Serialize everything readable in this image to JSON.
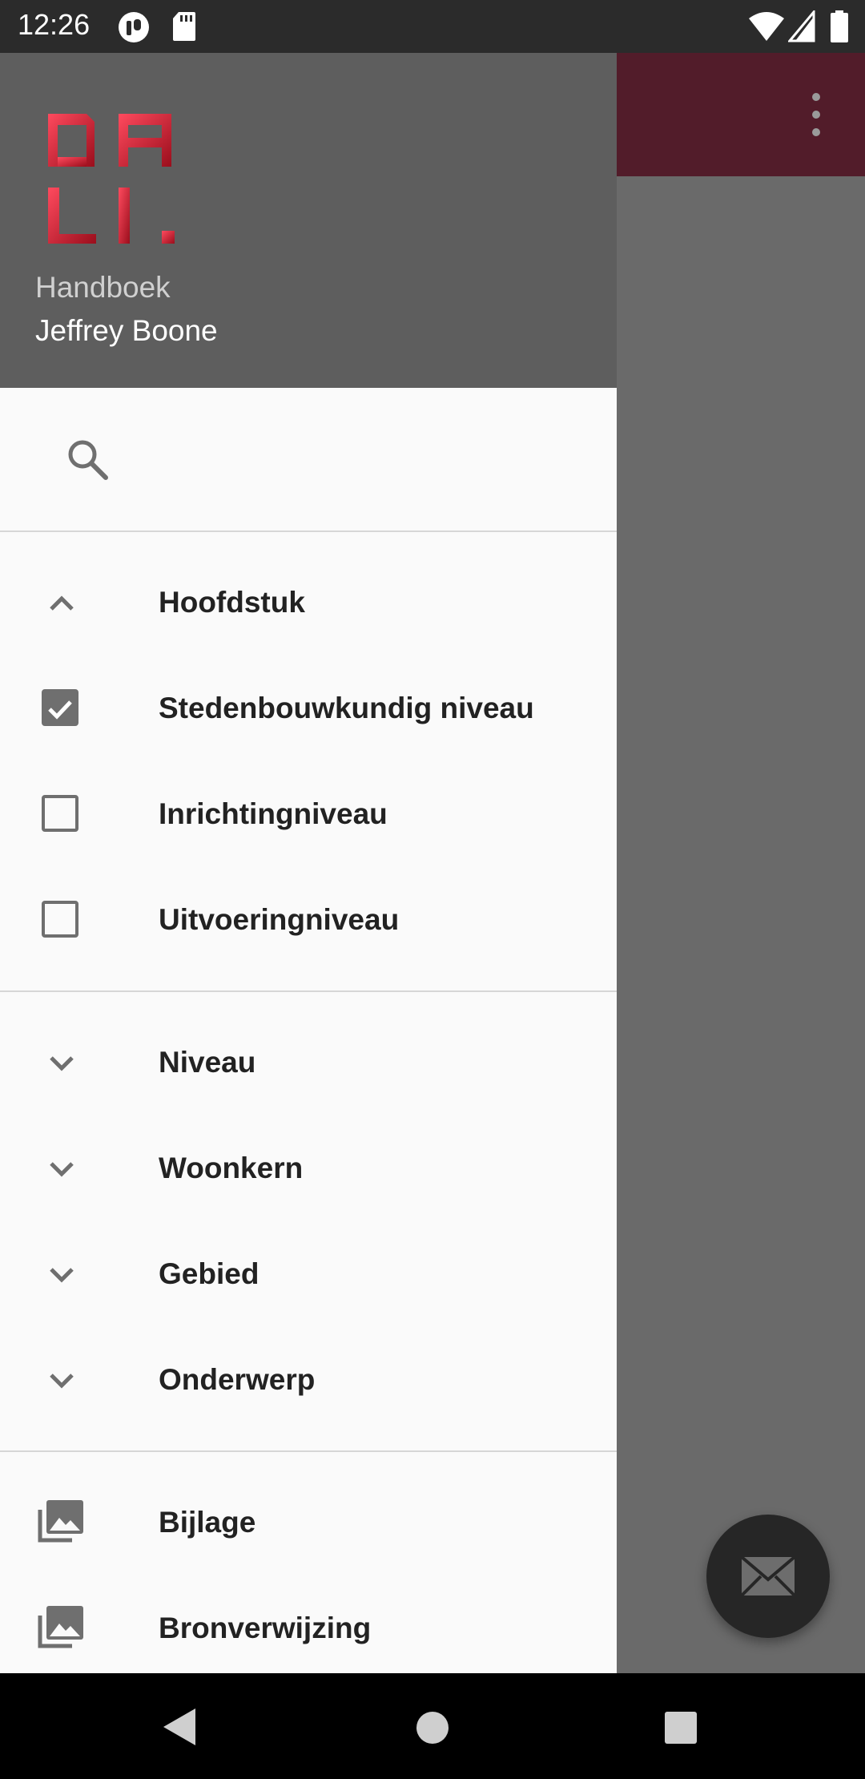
{
  "status_bar": {
    "time": "12:26",
    "left_icons": [
      "notification-app-icon",
      "sd-card-icon"
    ],
    "right_icons": [
      "wifi-icon",
      "signal-icon",
      "battery-icon"
    ]
  },
  "app": {
    "toolbar_color": "#521c2a",
    "overflow_icon": "more-vert-icon",
    "fab_icon": "mail-icon"
  },
  "drawer": {
    "header": {
      "logo_text": "DALI.",
      "subtitle": "Handboek",
      "name": "Jeffrey Boone"
    },
    "search": {
      "icon": "search-icon",
      "value": ""
    },
    "sections": [
      {
        "title": "Hoofdstuk",
        "expanded": true,
        "items": [
          {
            "label": "Stedenbouwkundig niveau",
            "checked": true
          },
          {
            "label": "Inrichtingniveau",
            "checked": false
          },
          {
            "label": "Uitvoeringniveau",
            "checked": false
          }
        ]
      },
      {
        "title": "Niveau",
        "expanded": false
      },
      {
        "title": "Woonkern",
        "expanded": false
      },
      {
        "title": "Gebied",
        "expanded": false
      },
      {
        "title": "Onderwerp",
        "expanded": false
      }
    ],
    "links": [
      {
        "label": "Bijlage",
        "icon": "image-library-icon"
      },
      {
        "label": "Bronverwijzing",
        "icon": "image-library-icon"
      }
    ]
  },
  "nav_bar": {
    "buttons": [
      "back-icon",
      "home-icon",
      "recents-icon"
    ]
  }
}
